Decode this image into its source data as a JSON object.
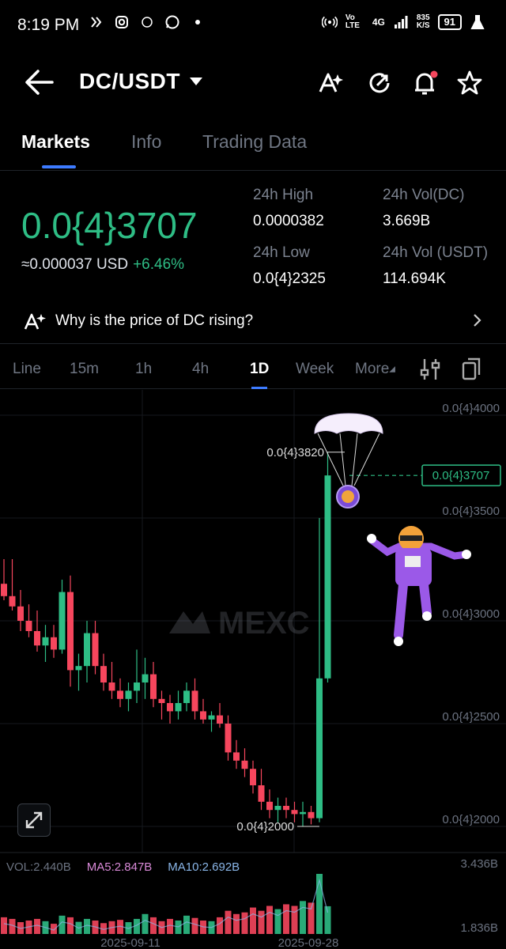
{
  "status_bar": {
    "time": "8:19 PM",
    "net_speed_value": "835",
    "net_speed_unit": "K/S",
    "network": "4G",
    "volte": "Vo LTE",
    "battery": "91"
  },
  "header": {
    "pair": "DC/USDT",
    "icons": [
      "ai-assist-icon",
      "refresh-icon",
      "bell-icon",
      "star-icon"
    ]
  },
  "tabs": [
    {
      "label": "Markets",
      "active": true
    },
    {
      "label": "Info",
      "active": false
    },
    {
      "label": "Trading Data",
      "active": false
    }
  ],
  "price": {
    "last": "0.0{4}3707",
    "usd": "≈0.000037 USD",
    "change": "+6.46%"
  },
  "stats": {
    "high_label": "24h High",
    "high_value": "0.0000382",
    "low_label": "24h Low",
    "low_value": "0.0{4}2325",
    "vol_dc_label": "24h Vol(DC)",
    "vol_dc_value": "3.669B",
    "vol_usdt_label": "24h Vol (USDT)",
    "vol_usdt_value": "114.694K"
  },
  "why_banner": {
    "text": "Why is the price of DC rising?"
  },
  "intervals": [
    {
      "label": "Line",
      "active": false
    },
    {
      "label": "15m",
      "active": false
    },
    {
      "label": "1h",
      "active": false
    },
    {
      "label": "4h",
      "active": false
    },
    {
      "label": "1D",
      "active": true
    },
    {
      "label": "Week",
      "active": false
    },
    {
      "label": "More",
      "active": false
    }
  ],
  "chart": {
    "watermark": "MEXC",
    "y_axis_labels": [
      "0.0{4}4000",
      "0.0{4}3500",
      "0.0{4}3000",
      "0.0{4}2500",
      "0.0{4}2000"
    ],
    "current_price_tag": "0.0{4}3707",
    "high_marker": "0.0{4}3820",
    "low_marker": "0.0{4}2000",
    "x_axis_labels": [
      "2025-09-11",
      "2025-09-28"
    ],
    "colors": {
      "up": "#2ebd85",
      "down": "#f6465d"
    }
  },
  "volume": {
    "vol": "VOL:2.440B",
    "ma5": "MA5:2.847B",
    "ma10": "MA10:2.692B",
    "axis_top": "3.436B",
    "axis_bottom": "1.836B"
  },
  "chart_data": {
    "type": "candlestick",
    "candles": [
      {
        "o": 3.18,
        "h": 3.3,
        "l": 3.1,
        "c": 3.12
      },
      {
        "o": 3.12,
        "h": 3.3,
        "l": 3.05,
        "c": 3.07
      },
      {
        "o": 3.07,
        "h": 3.15,
        "l": 2.95,
        "c": 3.0
      },
      {
        "o": 3.0,
        "h": 3.08,
        "l": 2.92,
        "c": 2.95
      },
      {
        "o": 2.95,
        "h": 3.05,
        "l": 2.85,
        "c": 2.88
      },
      {
        "o": 2.88,
        "h": 2.98,
        "l": 2.8,
        "c": 2.92
      },
      {
        "o": 2.92,
        "h": 2.98,
        "l": 2.82,
        "c": 2.86
      },
      {
        "o": 2.86,
        "h": 3.2,
        "l": 2.84,
        "c": 3.14
      },
      {
        "o": 3.14,
        "h": 3.22,
        "l": 2.68,
        "c": 2.76
      },
      {
        "o": 2.76,
        "h": 2.84,
        "l": 2.66,
        "c": 2.78
      },
      {
        "o": 2.78,
        "h": 3.0,
        "l": 2.7,
        "c": 2.94
      },
      {
        "o": 2.94,
        "h": 3.0,
        "l": 2.74,
        "c": 2.78
      },
      {
        "o": 2.78,
        "h": 2.84,
        "l": 2.66,
        "c": 2.7
      },
      {
        "o": 2.7,
        "h": 2.8,
        "l": 2.62,
        "c": 2.66
      },
      {
        "o": 2.66,
        "h": 2.72,
        "l": 2.58,
        "c": 2.62
      },
      {
        "o": 2.62,
        "h": 2.7,
        "l": 2.56,
        "c": 2.66
      },
      {
        "o": 2.66,
        "h": 2.86,
        "l": 2.6,
        "c": 2.7
      },
      {
        "o": 2.7,
        "h": 2.82,
        "l": 2.62,
        "c": 2.74
      },
      {
        "o": 2.74,
        "h": 2.8,
        "l": 2.58,
        "c": 2.62
      },
      {
        "o": 2.62,
        "h": 2.66,
        "l": 2.52,
        "c": 2.6
      },
      {
        "o": 2.6,
        "h": 2.64,
        "l": 2.5,
        "c": 2.56
      },
      {
        "o": 2.56,
        "h": 2.66,
        "l": 2.52,
        "c": 2.6
      },
      {
        "o": 2.6,
        "h": 2.7,
        "l": 2.56,
        "c": 2.66
      },
      {
        "o": 2.66,
        "h": 2.72,
        "l": 2.52,
        "c": 2.56
      },
      {
        "o": 2.56,
        "h": 2.62,
        "l": 2.5,
        "c": 2.52
      },
      {
        "o": 2.52,
        "h": 2.56,
        "l": 2.46,
        "c": 2.54
      },
      {
        "o": 2.54,
        "h": 2.6,
        "l": 2.48,
        "c": 2.5
      },
      {
        "o": 2.5,
        "h": 2.54,
        "l": 2.32,
        "c": 2.36
      },
      {
        "o": 2.36,
        "h": 2.42,
        "l": 2.28,
        "c": 2.32
      },
      {
        "o": 2.32,
        "h": 2.38,
        "l": 2.24,
        "c": 2.28
      },
      {
        "o": 2.28,
        "h": 2.32,
        "l": 2.16,
        "c": 2.2
      },
      {
        "o": 2.2,
        "h": 2.28,
        "l": 2.08,
        "c": 2.12
      },
      {
        "o": 2.12,
        "h": 2.18,
        "l": 2.04,
        "c": 2.08
      },
      {
        "o": 2.08,
        "h": 2.14,
        "l": 2.02,
        "c": 2.1
      },
      {
        "o": 2.1,
        "h": 2.14,
        "l": 2.04,
        "c": 2.08
      },
      {
        "o": 2.08,
        "h": 2.12,
        "l": 2.02,
        "c": 2.06
      },
      {
        "o": 2.06,
        "h": 2.12,
        "l": 2.0,
        "c": 2.07
      },
      {
        "o": 2.07,
        "h": 2.1,
        "l": 2.01,
        "c": 2.04
      },
      {
        "o": 2.04,
        "h": 3.5,
        "l": 2.02,
        "c": 2.72
      },
      {
        "o": 2.72,
        "h": 3.82,
        "l": 2.7,
        "c": 3.707
      }
    ],
    "y_unit": "0.0{4}xxxx",
    "ylim": [
      2.0,
      4.0
    ],
    "volumes": [
      2.1,
      2.05,
      1.95,
      2.0,
      2.05,
      1.98,
      1.9,
      2.15,
      2.1,
      1.96,
      2.05,
      2.0,
      1.92,
      1.98,
      2.02,
      1.95,
      2.05,
      2.2,
      2.1,
      1.98,
      2.05,
      2.0,
      2.15,
      2.08,
      2.0,
      1.98,
      2.1,
      2.3,
      2.2,
      2.25,
      2.4,
      2.3,
      2.45,
      2.35,
      2.5,
      2.45,
      2.6,
      2.55,
      3.436,
      2.44
    ],
    "vol_ylim": [
      1.836,
      3.436
    ]
  }
}
